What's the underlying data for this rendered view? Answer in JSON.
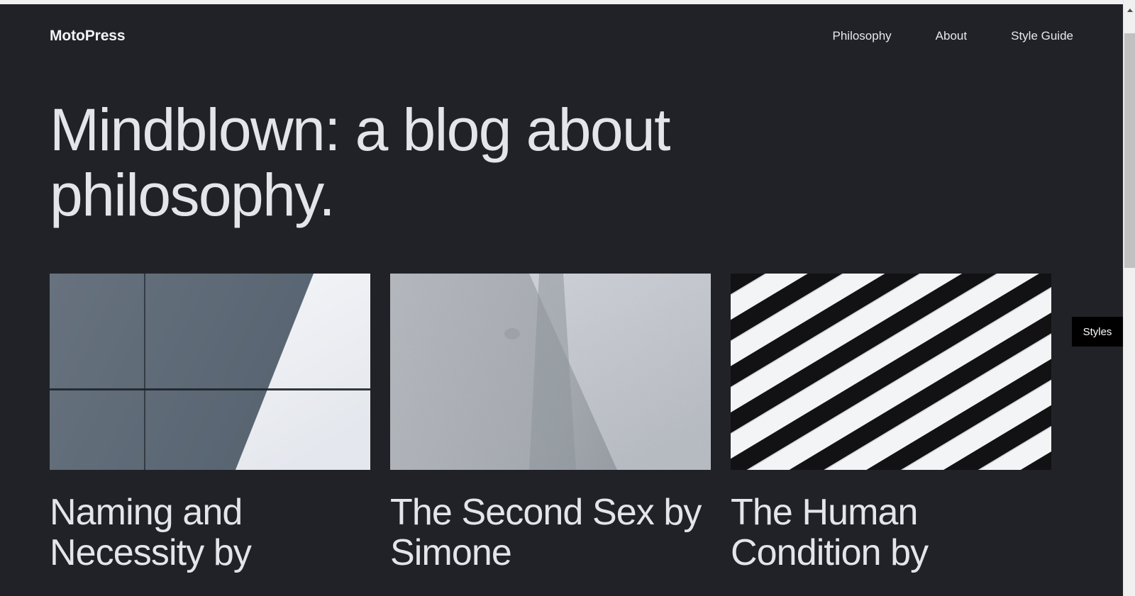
{
  "header": {
    "site_title": "MotoPress",
    "nav": [
      {
        "label": "Philosophy"
      },
      {
        "label": "About"
      },
      {
        "label": "Style Guide"
      }
    ]
  },
  "hero": {
    "title": "Mindblown: a blog about philosophy."
  },
  "posts": [
    {
      "title": "Naming and Necessity by",
      "thumb_name": "abstract-architecture-panels-photo",
      "thumb_alt": "Slate blue architectural panels with a diagonal white edge"
    },
    {
      "title": "The Second Sex by Simone",
      "thumb_name": "concrete-wall-texture-photo",
      "thumb_alt": "Textured grey concrete wall with a diagonal edge"
    },
    {
      "title": "The Human Condition by",
      "thumb_name": "diagonal-stripe-shadows-photo",
      "thumb_alt": "Black and white diagonal stripes of shadow on steps"
    }
  ],
  "overlay": {
    "styles_label": "Styles"
  },
  "colors": {
    "page_background": "#212227",
    "text_primary": "#e3e5e9",
    "tooltip_background": "#000000",
    "tooltip_text": "#ffffff",
    "scrollbar_track": "#f0f0f0",
    "scrollbar_thumb": "#c1c1c1"
  }
}
